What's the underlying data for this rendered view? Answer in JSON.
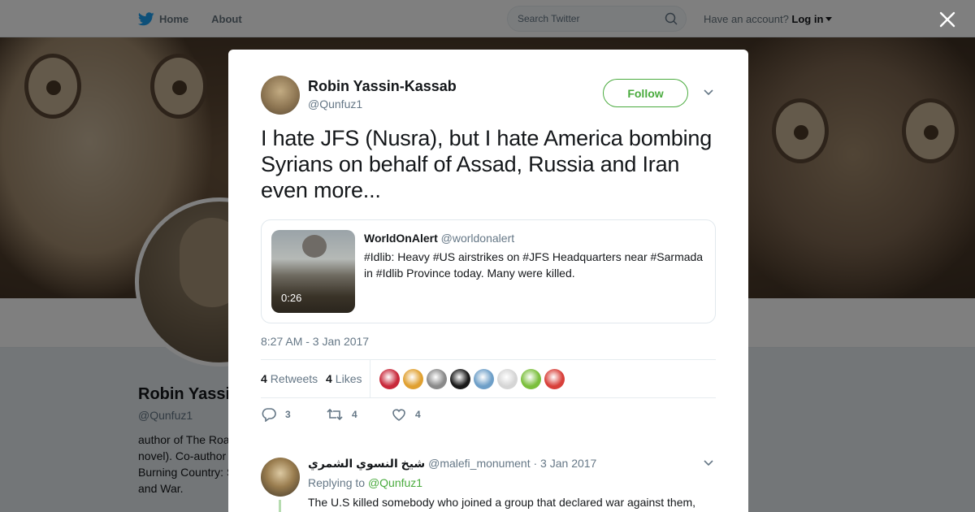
{
  "nav": {
    "home": "Home",
    "about": "About",
    "search_placeholder": "Search Twitter",
    "have_account": "Have an account?",
    "login": "Log in"
  },
  "profile": {
    "name": "Robin Yassin-Kassab",
    "handle": "@Qunfuz1",
    "bio_lines": [
      "author of The Roa",
      "novel). Co-author",
      "Burning Country: S",
      "and War."
    ]
  },
  "tweet": {
    "author_name": "Robin Yassin-Kassab",
    "author_handle": "@Qunfuz1",
    "follow_label": "Follow",
    "text": "I hate JFS (Nusra), but I hate America bombing Syrians on behalf of Assad, Russia and Iran even more...",
    "timestamp": "8:27 AM - 3 Jan 2017",
    "retweets_count": "4",
    "retweets_label": "Retweets",
    "likes_count": "4",
    "likes_label": "Likes",
    "reply_count": "3",
    "retweet_action_count": "4",
    "like_action_count": "4"
  },
  "quoted": {
    "name": "WorldOnAlert",
    "handle": "@worldonalert",
    "text": "#Idlib: Heavy #US airstrikes on #JFS Headquarters near #Sarmada in #Idlib Province today. Many were killed.",
    "duration": "0:26"
  },
  "likers_colors": [
    "#c8283a",
    "#e0a030",
    "#8a8a8a",
    "#1a1a1a",
    "#6e9fc8",
    "#d5d5d5",
    "#7bbf3c",
    "#d8403a"
  ],
  "reply": {
    "name": "شيخ النسوي الشمري",
    "handle": "@malefi_monument",
    "date": "· 3 Jan 2017",
    "replying_label": "Replying to",
    "replying_to": "@Qunfuz1",
    "text": "The U.S killed somebody who joined a group that declared war against them,"
  },
  "colors": {
    "accent": "#4aab3e",
    "twitter_blue": "#1da1f2",
    "muted": "#657786"
  }
}
